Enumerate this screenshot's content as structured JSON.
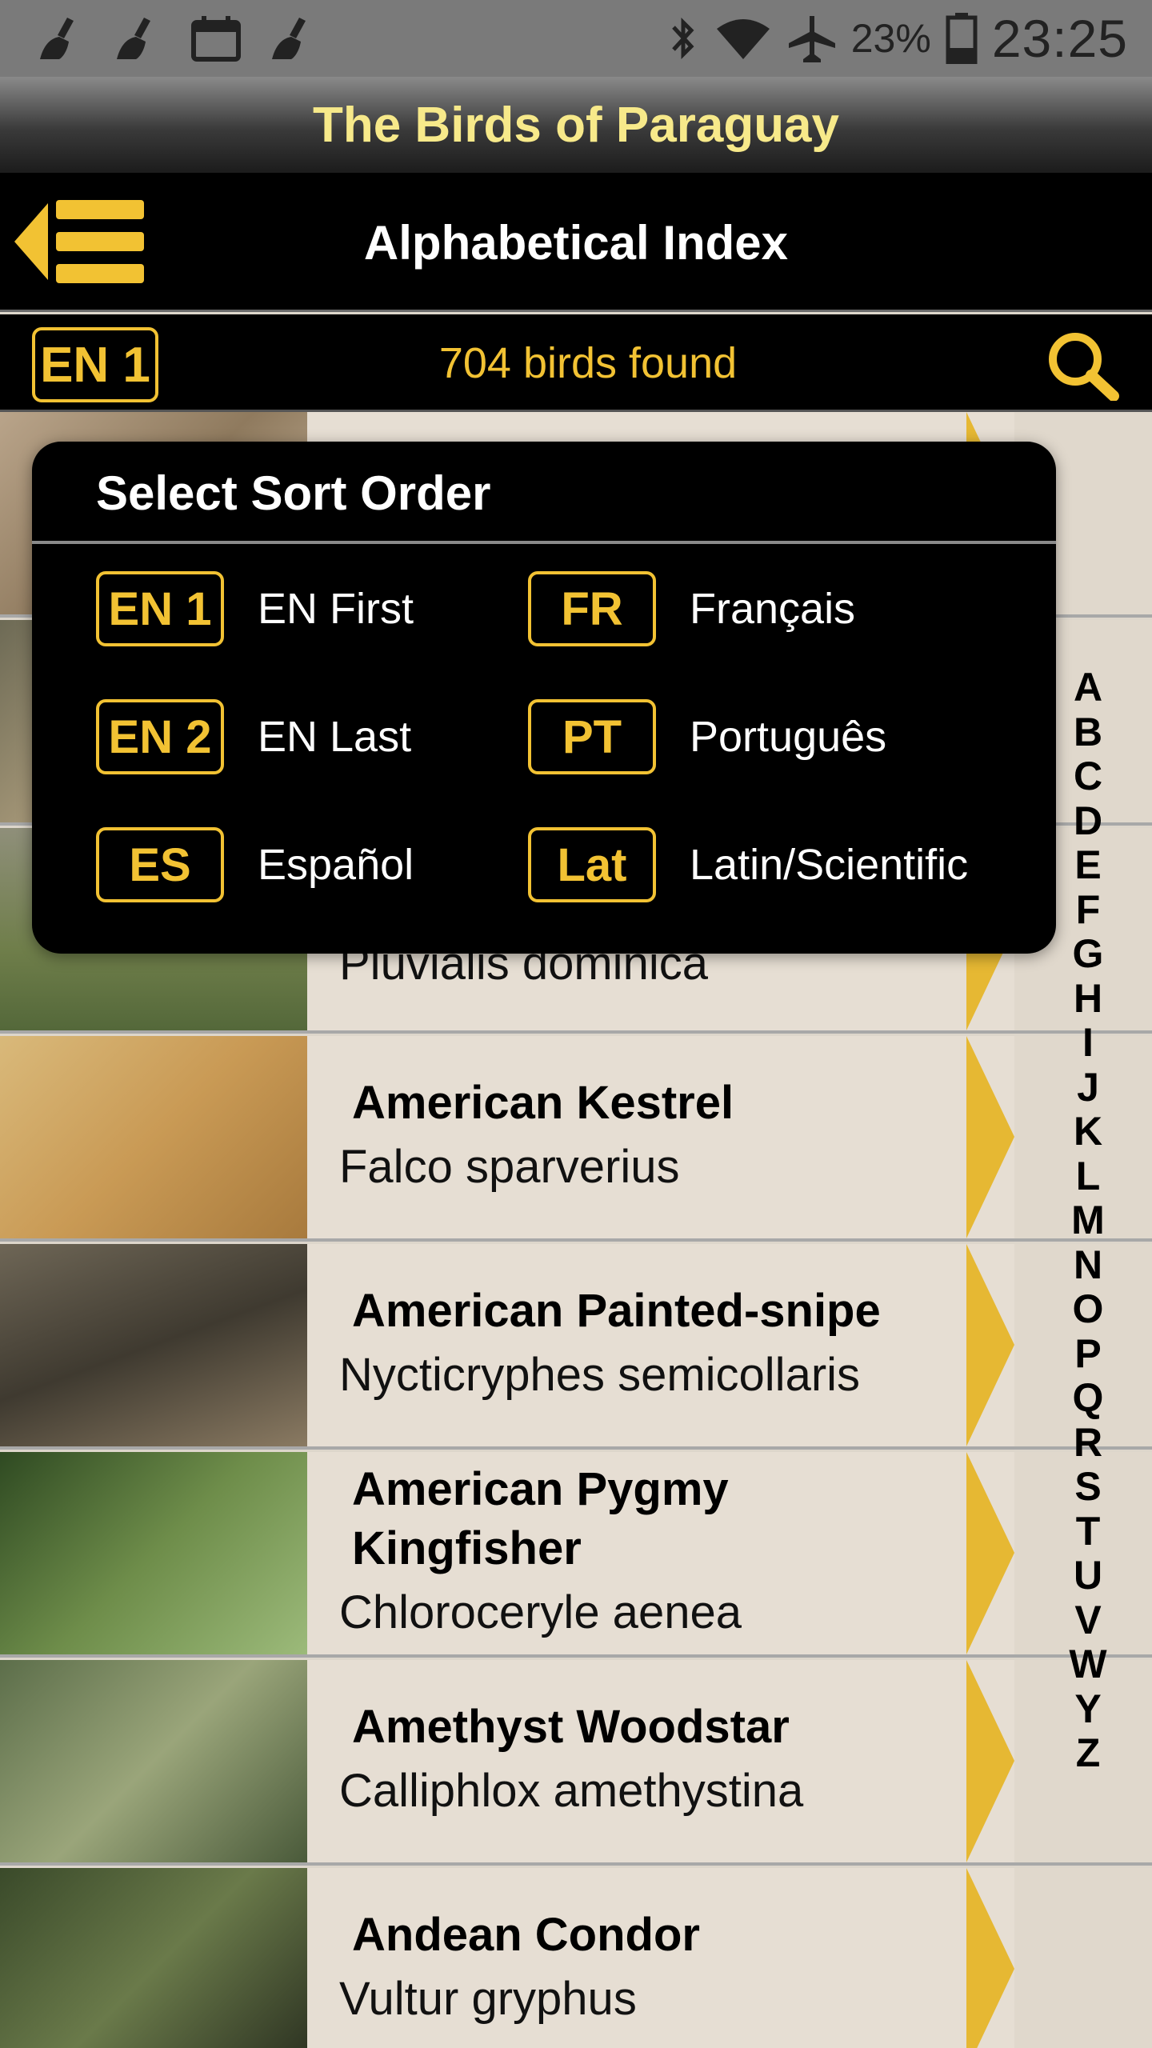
{
  "status_bar": {
    "battery_percent": "23%",
    "time": "23:25",
    "icons": [
      "broom-icon",
      "broom-icon",
      "calendar-icon",
      "broom-icon",
      "bluetooth-icon",
      "wifi-icon",
      "airplane-icon",
      "battery-icon"
    ]
  },
  "app": {
    "title": "The Birds of Paraguay"
  },
  "nav": {
    "title": "Alphabetical Index"
  },
  "info": {
    "current_sort": "EN 1",
    "count_text": "704 birds found"
  },
  "dialog": {
    "title": "Select Sort Order",
    "options": [
      {
        "code": "EN 1",
        "label": "EN First"
      },
      {
        "code": "FR",
        "label": "Français"
      },
      {
        "code": "EN 2",
        "label": "EN Last"
      },
      {
        "code": "PT",
        "label": "Português"
      },
      {
        "code": "ES",
        "label": "Español"
      },
      {
        "code": "Lat",
        "label": "Latin/Scientific"
      }
    ]
  },
  "rows": [
    {
      "common": "",
      "scientific": ""
    },
    {
      "common": "",
      "scientific": ""
    },
    {
      "common": "",
      "scientific": "Pluvialis dominica"
    },
    {
      "common": "American Kestrel",
      "scientific": "Falco sparverius"
    },
    {
      "common": "American Painted-snipe",
      "scientific": "Nycticryphes semicollaris"
    },
    {
      "common": "American Pygmy Kingfisher",
      "scientific": "Chloroceryle aenea"
    },
    {
      "common": "Amethyst Woodstar",
      "scientific": "Calliphlox amethystina"
    },
    {
      "common": "Andean Condor",
      "scientific": "Vultur gryphus"
    }
  ],
  "alphabet": [
    "A",
    "B",
    "C",
    "D",
    "E",
    "F",
    "G",
    "H",
    "I",
    "J",
    "K",
    "L",
    "M",
    "N",
    "O",
    "P",
    "Q",
    "R",
    "S",
    "T",
    "U",
    "V",
    "W",
    "Y",
    "Z"
  ],
  "colors": {
    "accent": "#f2c233",
    "title_yellow": "#f7e98a",
    "row_bg": "#e6ded3"
  }
}
